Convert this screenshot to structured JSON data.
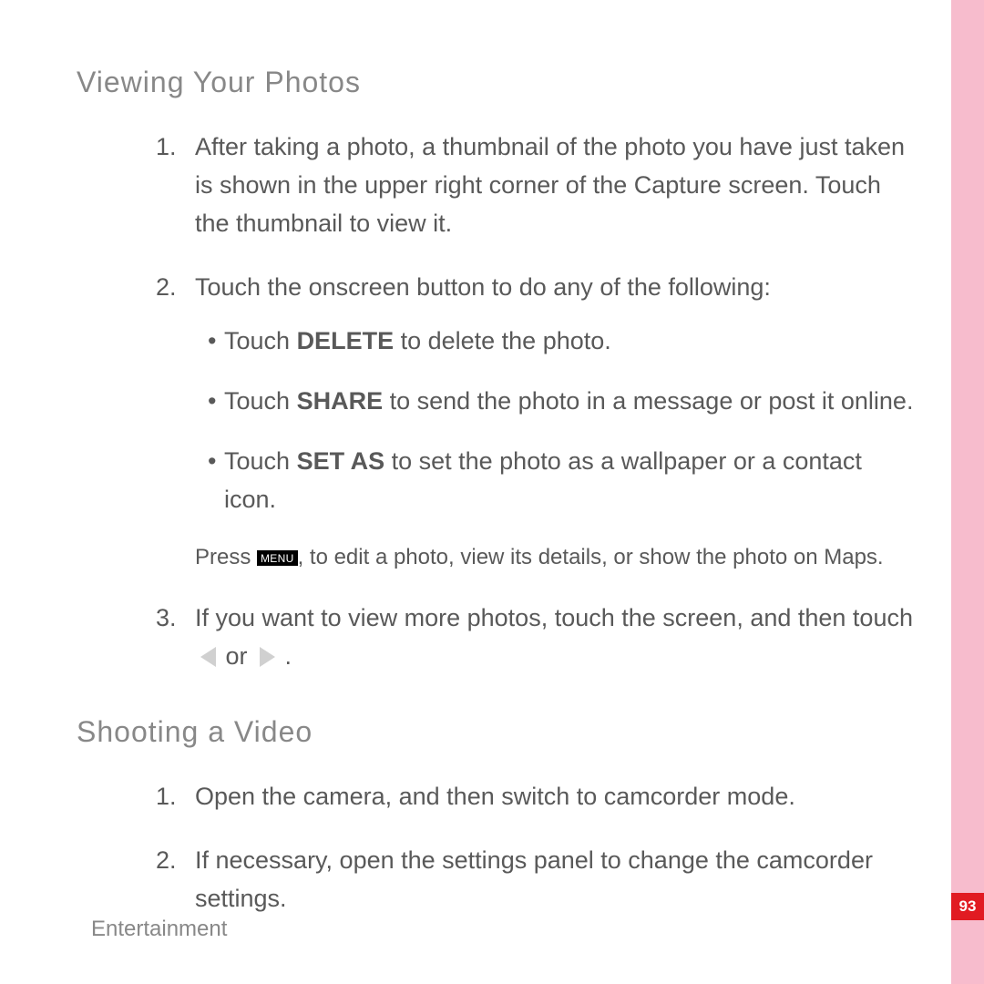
{
  "footer": "Entertainment",
  "page_number": "93",
  "sections": [
    {
      "heading": "Viewing Your Photos",
      "items": [
        {
          "num": "1.",
          "text": "After taking a photo, a thumbnail of the photo you have just taken is shown in the upper right corner of the Capture screen. Touch the thumbnail to view it."
        },
        {
          "num": "2.",
          "text": "Touch the onscreen button to do any of the following:",
          "bullets": [
            {
              "pre": "Touch ",
              "bold": "DELETE",
              "post": " to delete the photo."
            },
            {
              "pre": "Touch ",
              "bold": "SHARE",
              "post": " to send the photo in a message or post it online."
            },
            {
              "pre": "Touch ",
              "bold": "SET AS",
              "post": " to set the photo as a wallpaper or a contact icon."
            }
          ],
          "press": {
            "pre": "Press ",
            "key": "MENU",
            "post": ", to edit a photo, view its details, or show the photo on Maps."
          }
        },
        {
          "num": "3.",
          "text_pre": "If you want to view more photos, touch the screen, and then touch ",
          "text_mid": " or ",
          "text_post": " ."
        }
      ]
    },
    {
      "heading": "Shooting a Video",
      "items": [
        {
          "num": "1.",
          "text": "Open the camera, and then switch to camcorder mode."
        },
        {
          "num": "2.",
          "text": "If necessary, open the settings panel to change the camcorder settings."
        }
      ]
    }
  ]
}
